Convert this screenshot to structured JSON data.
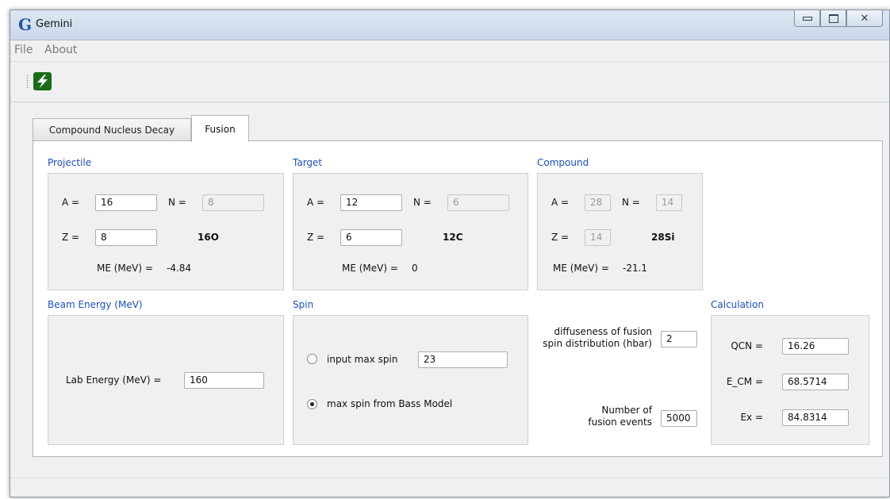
{
  "window": {
    "title": "Gemini",
    "icon_letter": "G",
    "controls": [
      "minimize-icon",
      "maximize-icon",
      "close-icon"
    ]
  },
  "menu": {
    "file": "File",
    "about": "About"
  },
  "toolbar": {
    "run_icon": "lightning-bolt-icon",
    "run_color": "#1b6b1b"
  },
  "tabs": [
    {
      "label": "Compound Nucleus Decay",
      "active": false
    },
    {
      "label": "Fusion",
      "active": true
    }
  ],
  "projectile": {
    "title": "Projectile",
    "a_label": "A =",
    "a_value": "16",
    "n_label": "N =",
    "n_value": "8",
    "z_label": "Z =",
    "z_value": "8",
    "symbol": "16O",
    "me_label": "ME (MeV) =",
    "me_value": "-4.84"
  },
  "target": {
    "title": "Target",
    "a_label": "A =",
    "a_value": "12",
    "n_label": "N =",
    "n_value": "6",
    "z_label": "Z =",
    "z_value": "6",
    "symbol": "12C",
    "me_label": "ME (MeV) =",
    "me_value": "0"
  },
  "compound": {
    "title": "Compound",
    "a_label": "A =",
    "a_value": "28",
    "n_label": "N =",
    "n_value": "14",
    "z_label": "Z =",
    "z_value": "14",
    "symbol": "28Si",
    "me_label": "ME (MeV) =",
    "me_value": "-21.1"
  },
  "beam": {
    "title": "Beam Energy (MeV)",
    "lab_label": "Lab Energy (MeV) =",
    "lab_value": "160"
  },
  "spin": {
    "title": "Spin",
    "input_label": "input max spin",
    "input_value": "23",
    "input_selected": false,
    "bass_label": "max spin from Bass Model",
    "bass_selected": true
  },
  "fusion": {
    "diffuseness_label_1": "diffuseness of fusion",
    "diffuseness_label_2": "spin distribution (hbar)",
    "diffuseness_value": "2",
    "events_label_1": "Number of",
    "events_label_2": "fusion events",
    "events_value": "5000"
  },
  "calculation": {
    "title": "Calculation",
    "qcn_label": "QCN =",
    "qcn_value": "16.26",
    "ecm_label": "E_CM =",
    "ecm_value": "68.5714",
    "ex_label": "Ex =",
    "ex_value": "84.8314"
  },
  "colors": {
    "group_title": "#1c4fc4",
    "group_bg": "#f0f0f0"
  }
}
